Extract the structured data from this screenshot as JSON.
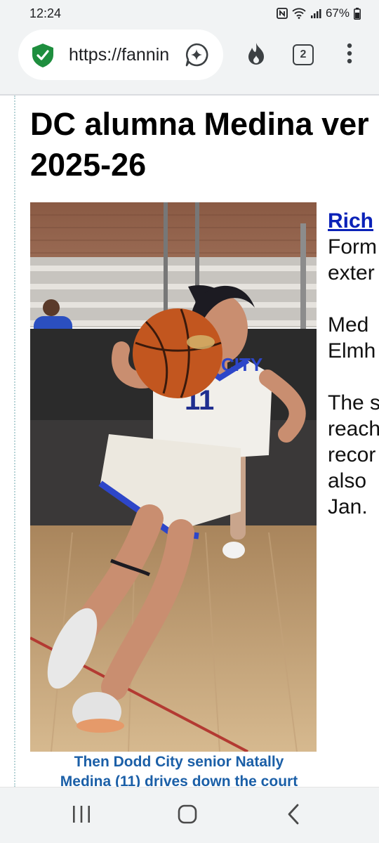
{
  "status": {
    "time": "12:24",
    "battery": "67%"
  },
  "browser": {
    "url": "https://fannin",
    "tab_count": "2"
  },
  "article": {
    "headline_line1": "DC alumna Medina ver",
    "headline_line2": "2025-26",
    "author": "Rich",
    "side_lines_p1": [
      "Form",
      "exter"
    ],
    "side_lines_p2": [
      "Med",
      "Elmh"
    ],
    "side_lines_p3": [
      "The s",
      "reach",
      "recor",
      "also",
      "Jan."
    ],
    "caption_line1": "Then Dodd City senior Natally",
    "caption_line2": "Medina (11) drives down the court"
  },
  "photo": {
    "jersey_text": "CITY",
    "jersey_number": "11"
  },
  "colors": {
    "shield": "#1e8e3e",
    "link": "#0b22b8",
    "caption": "#1b5fa7",
    "jersey_trim": "#2d46c9"
  }
}
